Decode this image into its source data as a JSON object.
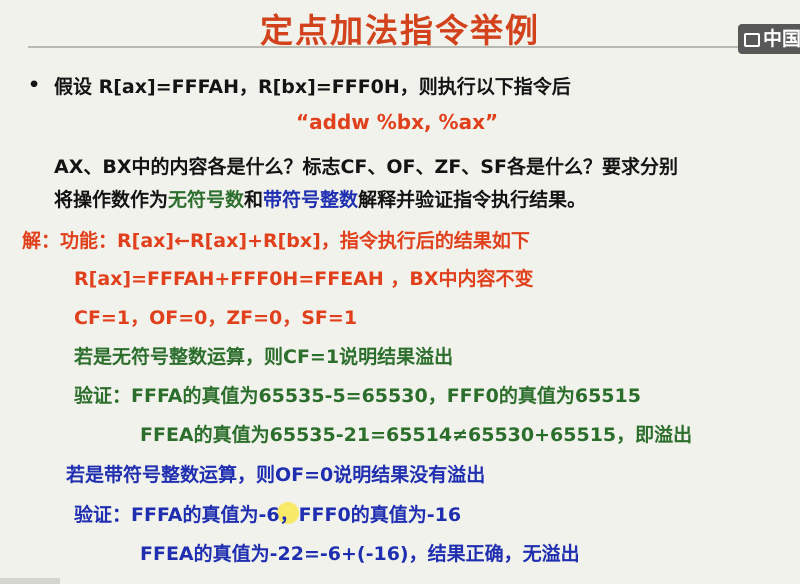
{
  "slide": {
    "title": "定点加法指令举例",
    "badge_text": "中国",
    "bullet": "•",
    "line1": "假设 R[ax]=FFFAH，R[bx]=FFF0H，则执行以下指令后",
    "instruction": "“addw %bx, %ax”",
    "line3": "AX、BX中的内容各是什么？标志CF、OF、ZF、SF各是什么？要求分别",
    "line4a": "将操作数作为",
    "line4b": "无符号数",
    "line4c": "和",
    "line4d": "带符号整数",
    "line4e": "解释并验证指令执行结果。",
    "sol1": "解：功能：R[ax]←R[ax]+R[bx]，指令执行后的结果如下",
    "sol2": "R[ax]=FFFAH+FFF0H=FFEAH ，BX中内容不变",
    "sol3": "CF=1，OF=0，ZF=0，SF=1",
    "unsigned1": "若是无符号整数运算，则CF=1说明结果溢出",
    "unsigned2": "验证：FFFA的真值为65535-5=65530，FFF0的真值为65515",
    "unsigned3": "FFEA的真值为65535-21=65514≠65530+65515，即溢出",
    "signed1": "若是带符号整数运算，则OF=0说明结果没有溢出",
    "signed2": "验证：FFFA的真值为-6，FFF0的真值为-16",
    "signed3": "FFEA的真值为-22=-6+(-16)，结果正确，无溢出"
  },
  "colors": {
    "title": "#d2421c",
    "black": "#141414",
    "red": "#e0401c",
    "green": "#2c6e2c",
    "blue": "#1f2fb0",
    "background": "#f2f2ec"
  }
}
